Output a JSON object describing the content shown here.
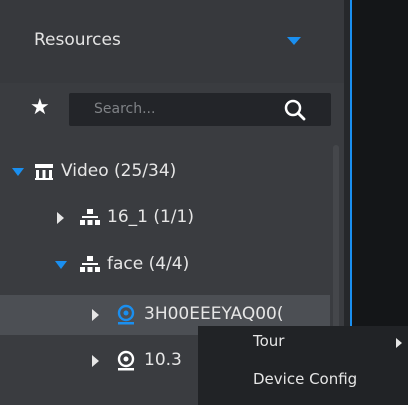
{
  "panel": {
    "title": "Resources"
  },
  "search": {
    "placeholder": "Search...",
    "favorites_icon": "star-icon",
    "search_icon": "search-icon"
  },
  "tree": {
    "video_group": {
      "label": "Video (25/34)",
      "icon": "video-group-icon",
      "expanded": true
    },
    "org_16_1": {
      "label": "16_1 (1/1)",
      "icon": "org-icon",
      "expanded": false
    },
    "org_face": {
      "label": "face (4/4)",
      "icon": "org-icon",
      "expanded": true
    },
    "device_1": {
      "label": "3H00EEEYAQ00(",
      "icon": "camera-icon",
      "expanded": false,
      "selected": true
    },
    "device_2": {
      "label": "10.3",
      "icon": "camera-icon",
      "expanded": false
    }
  },
  "context_menu": {
    "tour_label": "Tour",
    "device_config_label": "Device Config"
  },
  "colors": {
    "accent": "#1a8ff0",
    "panel_bg": "#3a3c40",
    "selected_row": "#4c4f54",
    "menu_bg": "#212326"
  }
}
